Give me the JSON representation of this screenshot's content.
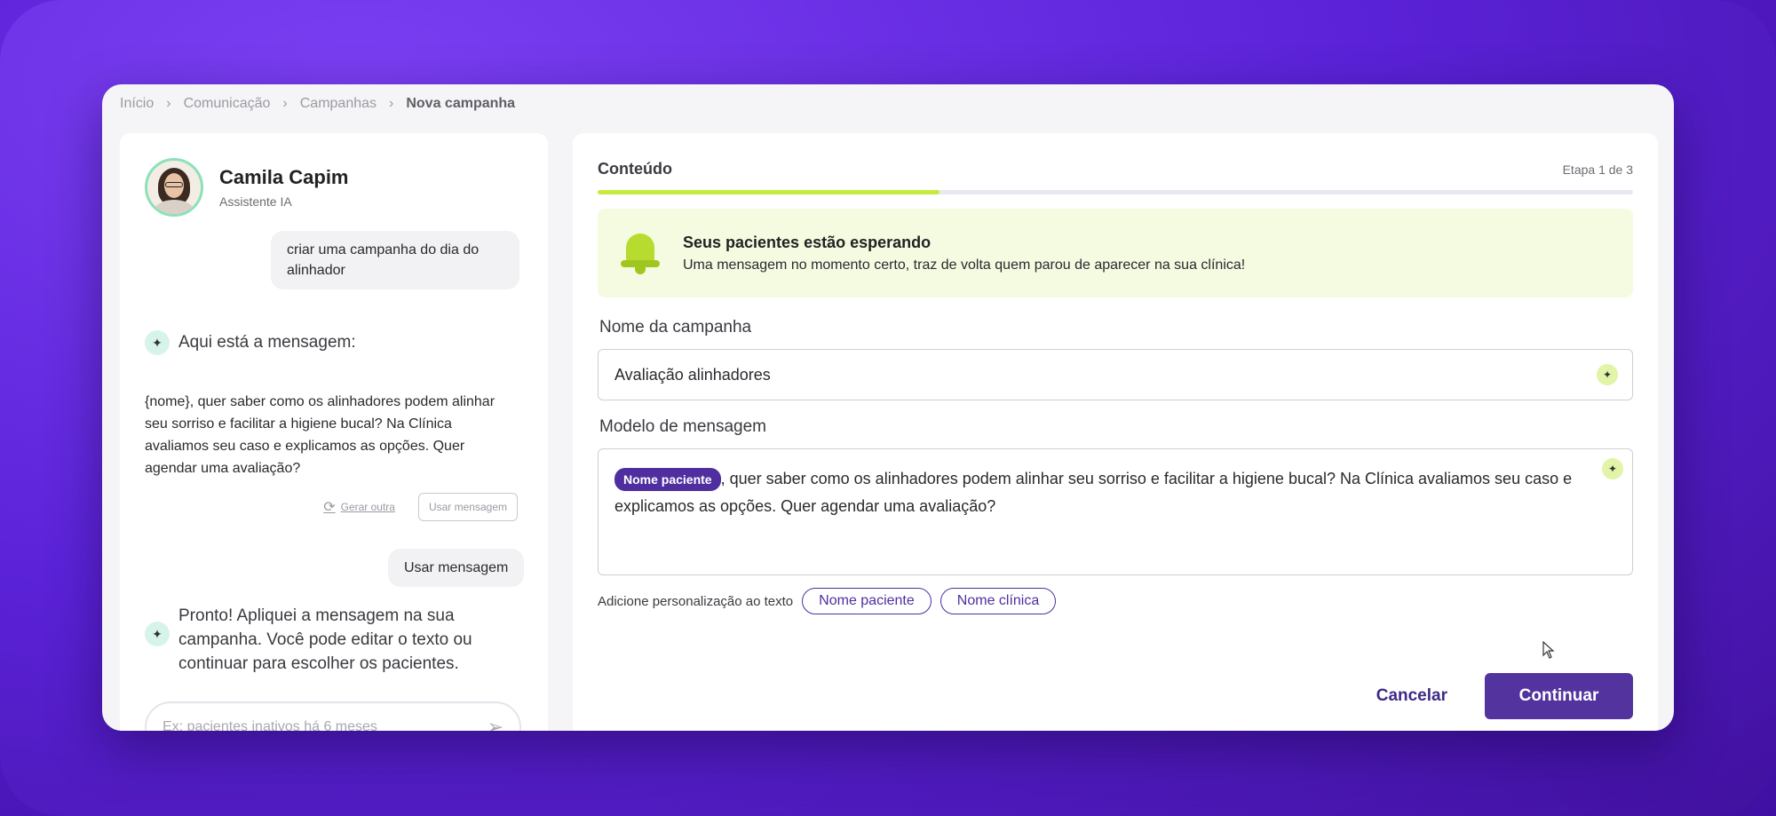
{
  "breadcrumb": {
    "items": [
      "Início",
      "Comunicação",
      "Campanhas"
    ],
    "current": "Nova campanha"
  },
  "assistant": {
    "name": "Camila Capim",
    "role": "Assistente IA"
  },
  "chat": {
    "user_message_1": "criar uma campanha do dia do alinhador",
    "ai_title": "Aqui está a mensagem:",
    "ai_message": "{nome}, quer saber como os alinhadores podem alinhar seu sorriso e facilitar a higiene bucal? Na Clínica avaliamos seu caso e explicamos as opções. Quer agendar uma avaliação?",
    "regenerate_label": "Gerar outra",
    "use_message_label": "Usar mensagem",
    "user_message_2": "Usar mensagem",
    "ai_done": "Pronto! Apliquei a mensagem na sua campanha. Você pode editar o texto ou continuar para escolher os pacientes.",
    "input_placeholder": "Ex: pacientes inativos há 6 meses"
  },
  "step": {
    "title": "Conteúdo",
    "count": "Etapa 1 de 3",
    "progress": 0.33
  },
  "banner": {
    "title": "Seus pacientes estão esperando",
    "text": "Uma mensagem no momento certo, traz de volta quem parou de aparecer na sua clínica!"
  },
  "form": {
    "name_label": "Nome da campanha",
    "name_value": "Avaliação alinhadores",
    "template_label": "Modelo de mensagem",
    "template_chip": "Nome paciente",
    "template_text": ", quer saber como os alinhadores podem alinhar seu sorriso e facilitar a higiene bucal? Na Clínica avaliamos seu caso e explicamos as opções. Quer agendar uma avaliação?",
    "personalize_label": "Adicione personalização ao texto",
    "tags": [
      "Nome paciente",
      "Nome clínica"
    ]
  },
  "buttons": {
    "cancel": "Cancelar",
    "continue": "Continuar"
  },
  "colors": {
    "accent": "#53349f",
    "progress": "#c6eb3f",
    "banner_bg": "#f5fbe1"
  }
}
